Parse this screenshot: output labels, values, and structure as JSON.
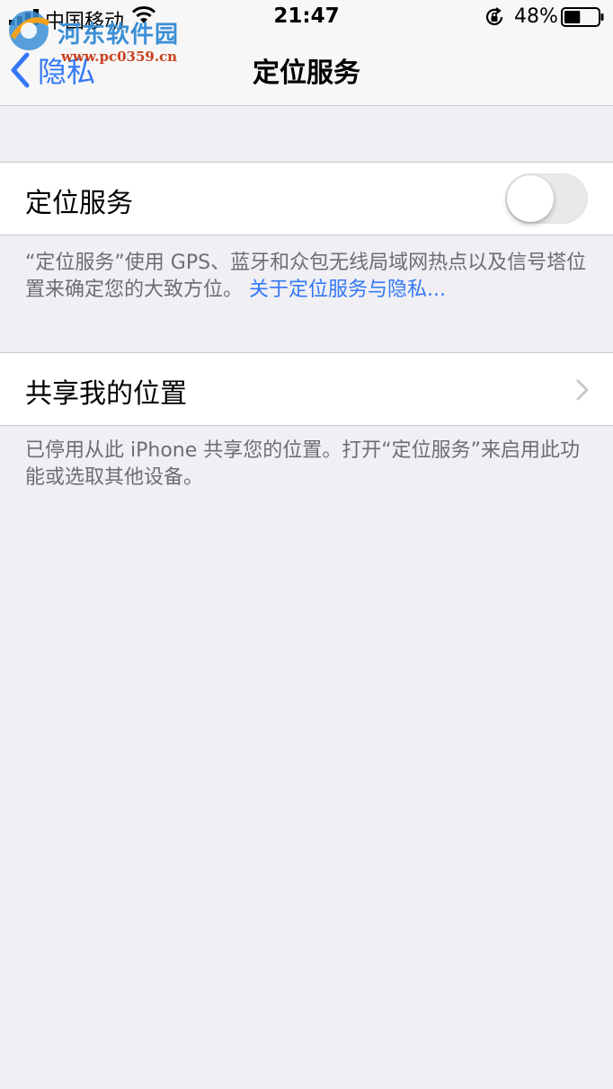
{
  "status_bar": {
    "carrier": "中国移动",
    "time": "21:47",
    "battery_percent": "48%",
    "battery_level": 0.48
  },
  "watermark": {
    "name": "河东软件园",
    "url": "www.pc0359.cn"
  },
  "nav": {
    "back_label": "隐私",
    "title": "定位服务"
  },
  "location_services": {
    "label": "定位服务",
    "enabled": false,
    "footnote_text": "“定位服务”使用 GPS、蓝牙和众包无线局域网热点以及信号塔位置来确定您的大致方位。",
    "footnote_link": "关于定位服务与隐私..."
  },
  "share_location": {
    "label": "共享我的位置",
    "footnote": "已停用从此 iPhone 共享您的位置。打开“定位服务”来启用此功能或选取其他设备。"
  },
  "colors": {
    "accent": "#3478f6",
    "background": "#efeff4",
    "footnote_text": "#6d6d72"
  }
}
